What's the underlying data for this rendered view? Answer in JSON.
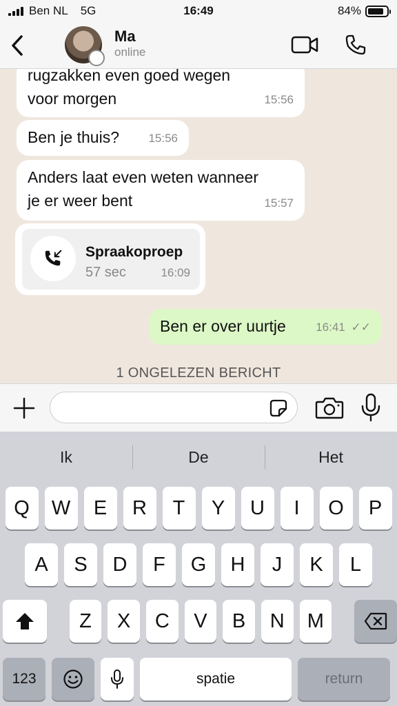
{
  "status_bar": {
    "carrier": "Ben NL",
    "network": "5G",
    "time": "16:49",
    "battery": "84%",
    "battery_level": 0.84
  },
  "header": {
    "contact_name": "Ma",
    "contact_status": "online"
  },
  "messages": [
    {
      "line1": "rugzakken even goed wegen",
      "line2": "voor morgen",
      "time": "15:56"
    },
    {
      "text": "Ben je thuis?",
      "time": "15:56"
    },
    {
      "line1": "Anders laat even weten wanneer",
      "line2": "je er weer bent",
      "time": "15:57"
    },
    {
      "call_title": "Spraakoproep",
      "call_duration": "57 sec",
      "time": "16:09"
    },
    {
      "text": "Ben er over uurtje",
      "time": "16:41"
    }
  ],
  "unread_label": "1 ONGELEZEN BERICHT",
  "keyboard": {
    "suggestions": [
      "Ik",
      "De",
      "Het"
    ],
    "row1": [
      "Q",
      "W",
      "E",
      "R",
      "T",
      "Y",
      "U",
      "I",
      "O",
      "P"
    ],
    "row2": [
      "A",
      "S",
      "D",
      "F",
      "G",
      "H",
      "J",
      "K",
      "L"
    ],
    "row3": [
      "Z",
      "X",
      "C",
      "V",
      "B",
      "N",
      "M"
    ],
    "numbers_label": "123",
    "space_label": "spatie",
    "return_label": "return"
  }
}
